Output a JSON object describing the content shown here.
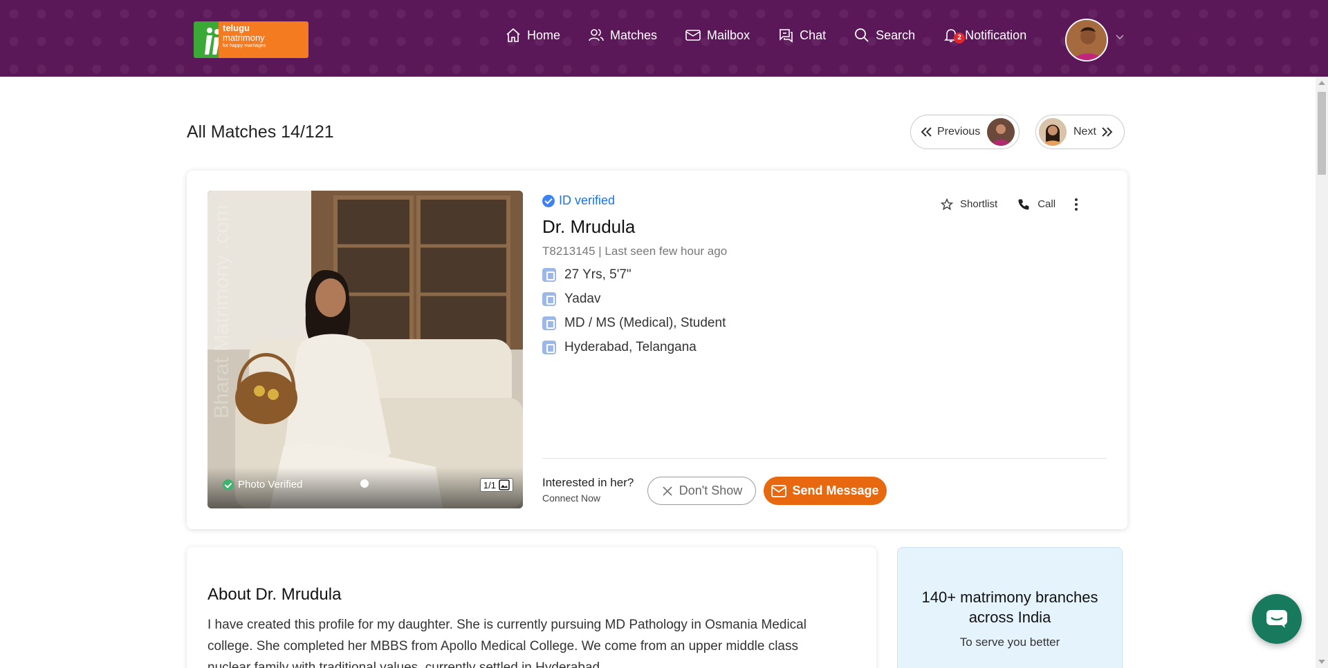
{
  "header": {
    "logo": {
      "line1": "telugu",
      "line2": "matrimony",
      "line3": "for happy marriages"
    },
    "nav": [
      {
        "label": "Home",
        "icon": "home-icon"
      },
      {
        "label": "Matches",
        "icon": "users-icon"
      },
      {
        "label": "Mailbox",
        "icon": "mail-icon"
      },
      {
        "label": "Chat",
        "icon": "chat-icon"
      },
      {
        "label": "Search",
        "icon": "search-icon"
      },
      {
        "label": "Notification",
        "icon": "bell-icon",
        "badge": "2"
      }
    ],
    "colors": {
      "bar": "#5b1858",
      "badge": "#e5272b"
    }
  },
  "page": {
    "title": "All Matches 14/121",
    "previous_label": "Previous",
    "next_label": "Next"
  },
  "profile": {
    "id_verified": "ID verified",
    "name": "Dr. Mrudula",
    "meta": "T8213145 | Last seen few hour ago",
    "details": [
      {
        "icon": "age-icon",
        "text": "27 Yrs, 5'7\""
      },
      {
        "icon": "caste-icon",
        "text": "Yadav"
      },
      {
        "icon": "education-icon",
        "text": "MD / MS (Medical), Student"
      },
      {
        "icon": "location-icon",
        "text": "Hyderabad, Telangana"
      }
    ],
    "photo_verified": "Photo Verified",
    "photo_count": "1/1",
    "watermark": "Bharat Matrimony .com",
    "actions": {
      "shortlist": "Shortlist",
      "call": "Call"
    },
    "interested": "Interested in her?",
    "connect": "Connect Now",
    "dont_show": "Don't Show",
    "send_message": "Send Message",
    "colors": {
      "accent": "#e8680f",
      "verified": "#1a73e8",
      "photo_verified": "#3db36d"
    }
  },
  "about": {
    "heading": "About Dr. Mrudula",
    "text": "I have created this profile for my daughter. She is currently pursuing MD Pathology in Osmania Medical college. She completed her MBBS from Apollo Medical College. We come from an upper middle class nuclear family with traditional values, currently settled in Hyderabad."
  },
  "branches": {
    "title": "140+ matrimony branches across India",
    "subtitle": "To serve you better"
  }
}
